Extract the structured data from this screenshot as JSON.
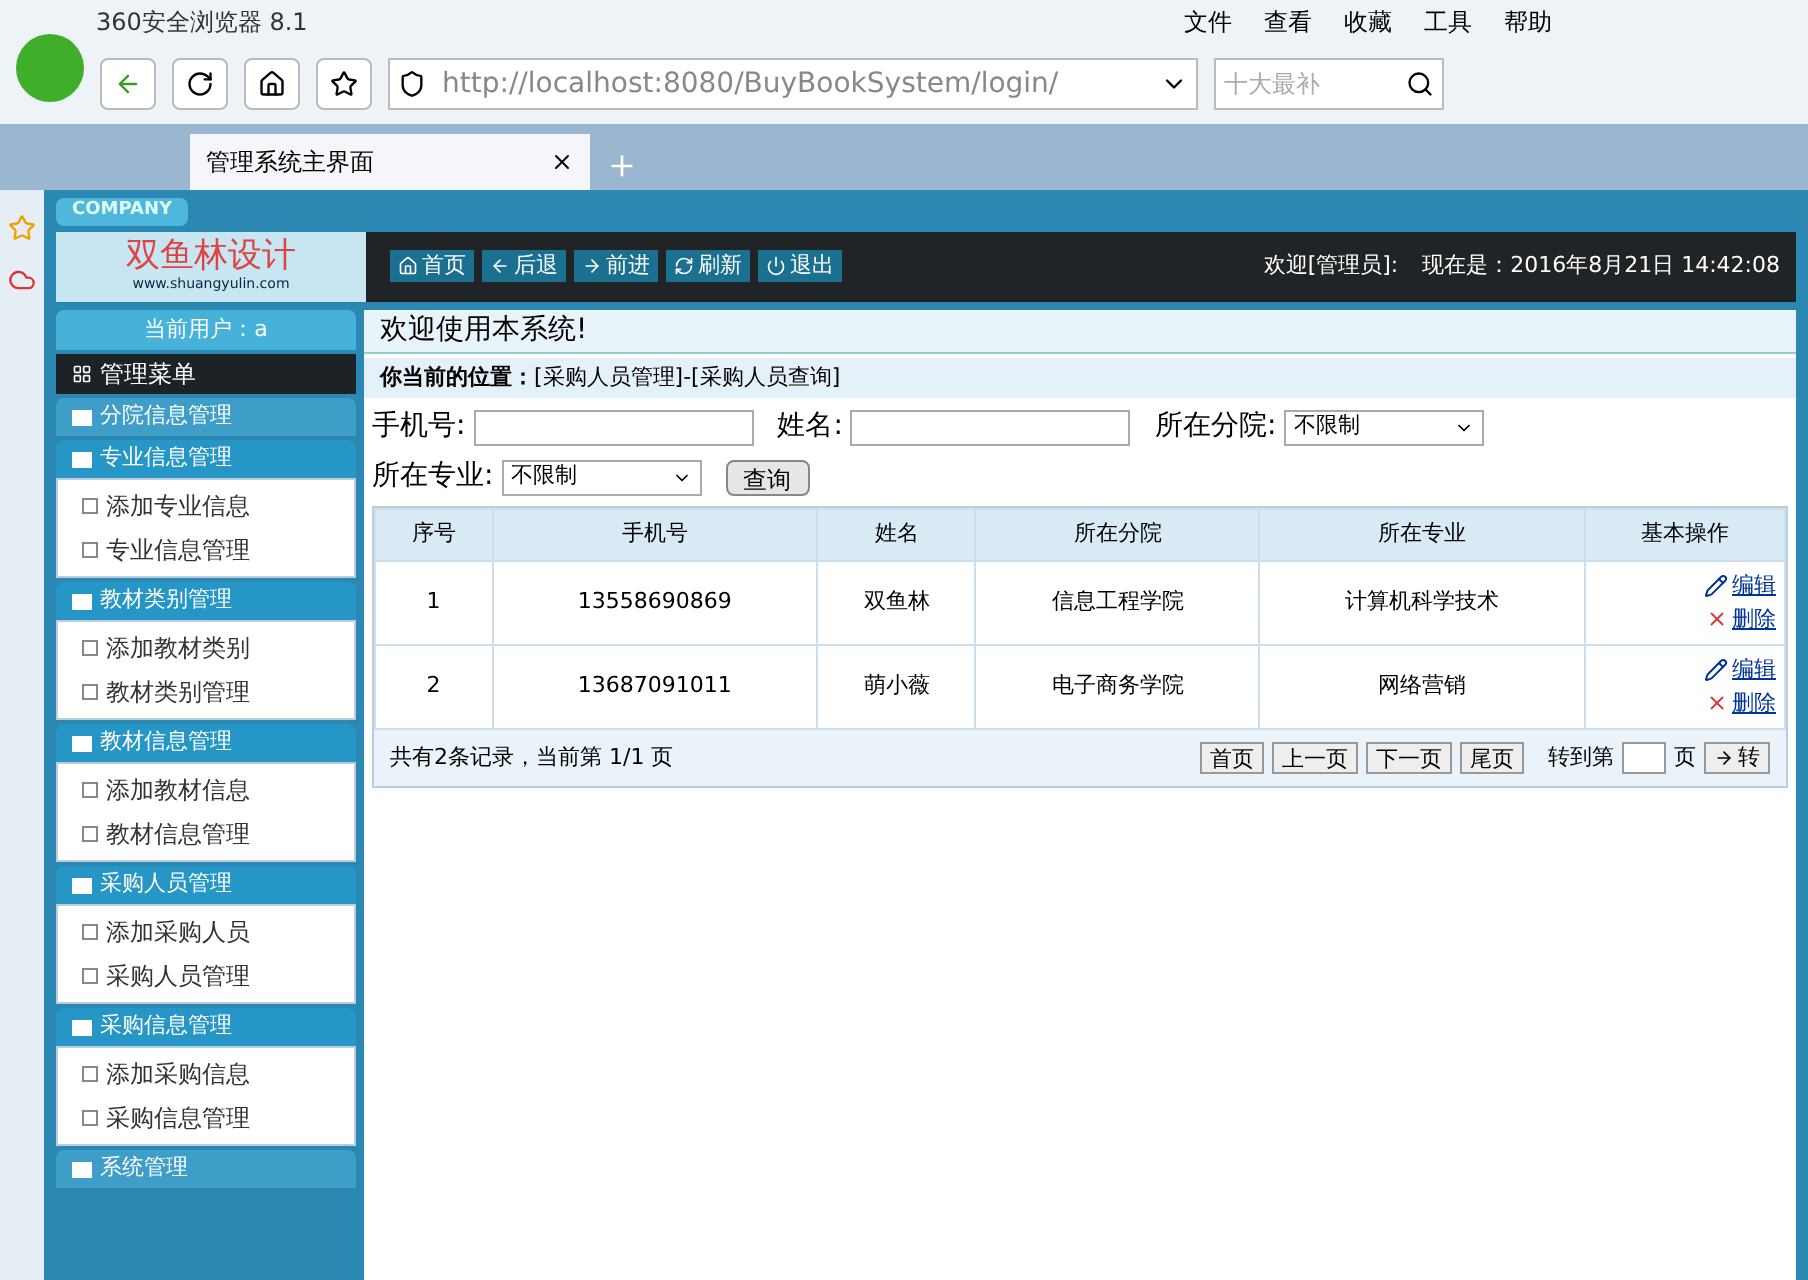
{
  "browser": {
    "title": "360安全浏览器 8.1",
    "menu": [
      "文件",
      "查看",
      "收藏",
      "工具",
      "帮助"
    ],
    "address": "http://localhost:8080/BuyBookSystem/login/",
    "search_placeholder": "十大最补",
    "tab": {
      "label": "管理系统主界面",
      "selected": true
    }
  },
  "header": {
    "company": "COMPANY",
    "logo": "双鱼林设计",
    "logo_url": "www.shuangyulin.com",
    "nav": [
      {
        "label": "首页",
        "kind": "home"
      },
      {
        "label": "后退",
        "kind": "back"
      },
      {
        "label": "前进",
        "kind": "forward"
      },
      {
        "label": "刷新",
        "kind": "refresh"
      },
      {
        "label": "退出",
        "kind": "power"
      }
    ],
    "welcome": "欢迎[管理员]:",
    "time": "现在是：2016年8月21日 14:42:08"
  },
  "sidebar": {
    "current_user": "当前用户：a",
    "menu_title": "管理菜单",
    "groups": [
      {
        "label": "分院信息管理",
        "expanded": false
      },
      {
        "label": "专业信息管理",
        "expanded": true,
        "items": [
          "添加专业信息",
          "专业信息管理"
        ]
      },
      {
        "label": "教材类别管理",
        "expanded": true,
        "items": [
          "添加教材类别",
          "教材类别管理"
        ]
      },
      {
        "label": "教材信息管理",
        "expanded": true,
        "items": [
          "添加教材信息",
          "教材信息管理"
        ]
      },
      {
        "label": "采购人员管理",
        "expanded": true,
        "items": [
          "添加采购人员",
          "采购人员管理"
        ]
      },
      {
        "label": "采购信息管理",
        "expanded": true,
        "items": [
          "添加采购信息",
          "采购信息管理"
        ]
      },
      {
        "label": "系统管理",
        "expanded": false
      }
    ]
  },
  "content": {
    "welcome": "欢迎使用本系统!",
    "location_label": "你当前的位置：",
    "location": "[采购人员管理]-[采购人员查询]",
    "filters": [
      {
        "label": "手机号:",
        "kind": "input"
      },
      {
        "label": "姓名:",
        "kind": "input"
      },
      {
        "label": "所在分院:",
        "kind": "select",
        "value": "不限制"
      },
      {
        "label": "所在专业:",
        "kind": "select",
        "value": "不限制"
      }
    ],
    "search_button": "查询",
    "table": {
      "columns": [
        "序号",
        "手机号",
        "姓名",
        "所在分院",
        "所在专业",
        "基本操作"
      ],
      "rows": [
        {
          "cells": [
            "1",
            "13558690869",
            "双鱼林",
            "信息工程学院",
            "计算机科学技术"
          ],
          "edit": "编辑",
          "delete": "删除"
        },
        {
          "cells": [
            "2",
            "13687091011",
            "萌小薇",
            "电子商务学院",
            "网络营销"
          ],
          "edit": "编辑",
          "delete": "删除"
        }
      ]
    },
    "pager": {
      "summary": "共有2条记录，当前第 1/1 页",
      "buttons": [
        "首页",
        "上一页",
        "下一页",
        "尾页"
      ],
      "goto_label": "转到第",
      "page_label": "页",
      "go_button": "转"
    }
  }
}
